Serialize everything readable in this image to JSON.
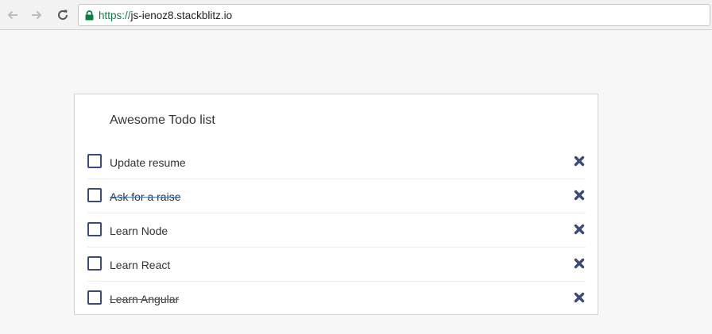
{
  "browser": {
    "url_scheme": "https://",
    "url_host": "js-ienoz8.stackblitz.io",
    "icons": {
      "back": "arrow-left-icon",
      "forward": "arrow-right-icon",
      "reload": "reload-icon",
      "secure": "lock-icon"
    },
    "secure_color": "#0b8043"
  },
  "todo": {
    "title": "Awesome Todo list",
    "accent_color": "#3b4a7a",
    "items": [
      {
        "label": "Update resume",
        "done": false
      },
      {
        "label": "Ask for a raise",
        "done": true
      },
      {
        "label": "Learn Node",
        "done": false
      },
      {
        "label": "Learn React",
        "done": false
      },
      {
        "label": "Learn Angular",
        "done": true
      }
    ]
  }
}
